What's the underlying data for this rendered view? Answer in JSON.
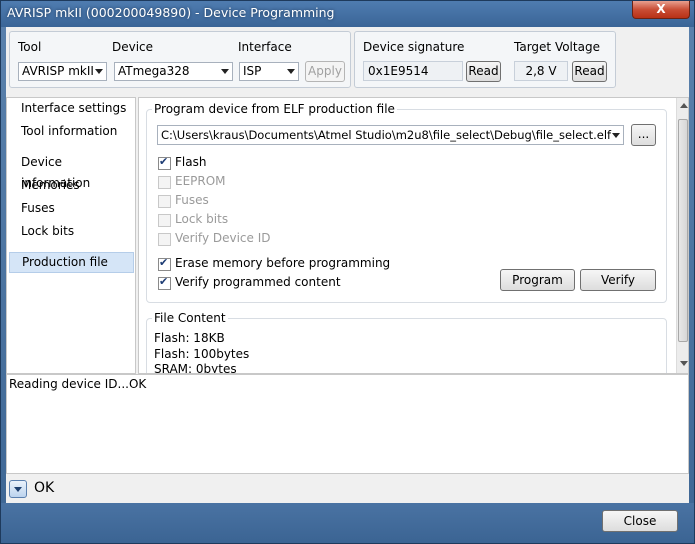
{
  "window": {
    "title": "AVRISP mkII (000200049890) - Device Programming",
    "close_symbol": "X"
  },
  "toolbar": {
    "tool_label": "Tool",
    "tool_value": "AVRISP mkII",
    "device_label": "Device",
    "device_value": "ATmega328",
    "interface_label": "Interface",
    "interface_value": "ISP",
    "apply_label": "Apply",
    "signature_label": "Device signature",
    "signature_value": "0x1E9514",
    "signature_read": "Read",
    "voltage_label": "Target Voltage",
    "voltage_value": "2,8 V",
    "voltage_read": "Read"
  },
  "sidebar": {
    "items": [
      {
        "label": "Interface settings"
      },
      {
        "label": "Tool information"
      },
      {
        "label": "Device information"
      },
      {
        "label": "Memories"
      },
      {
        "label": "Fuses"
      },
      {
        "label": "Lock bits"
      },
      {
        "label": "Production file"
      }
    ],
    "selected": "Production file"
  },
  "production": {
    "legend": "Program device from ELF production file",
    "file_path": "C:\\Users\\kraus\\Documents\\Atmel Studio\\m2u8\\file_select\\Debug\\file_select.elf",
    "browse_label": "...",
    "options": [
      {
        "label": "Flash",
        "checked": true,
        "enabled": true
      },
      {
        "label": "EEPROM",
        "checked": false,
        "enabled": false
      },
      {
        "label": "Fuses",
        "checked": false,
        "enabled": false
      },
      {
        "label": "Lock bits",
        "checked": false,
        "enabled": false
      },
      {
        "label": "Verify Device ID",
        "checked": false,
        "enabled": false
      }
    ],
    "erase_label": "Erase memory before programming",
    "erase_checked": true,
    "verify_label": "Verify programmed content",
    "verify_checked": true,
    "program_button": "Program",
    "verify_button": "Verify"
  },
  "file_content": {
    "legend": "File Content",
    "lines": [
      "Flash: 18KB",
      "Flash: 100bytes",
      "SRAM: 0bytes"
    ]
  },
  "log": {
    "message": "Reading device ID...OK"
  },
  "status": {
    "text": "OK"
  },
  "footer": {
    "close_button": "Close"
  }
}
